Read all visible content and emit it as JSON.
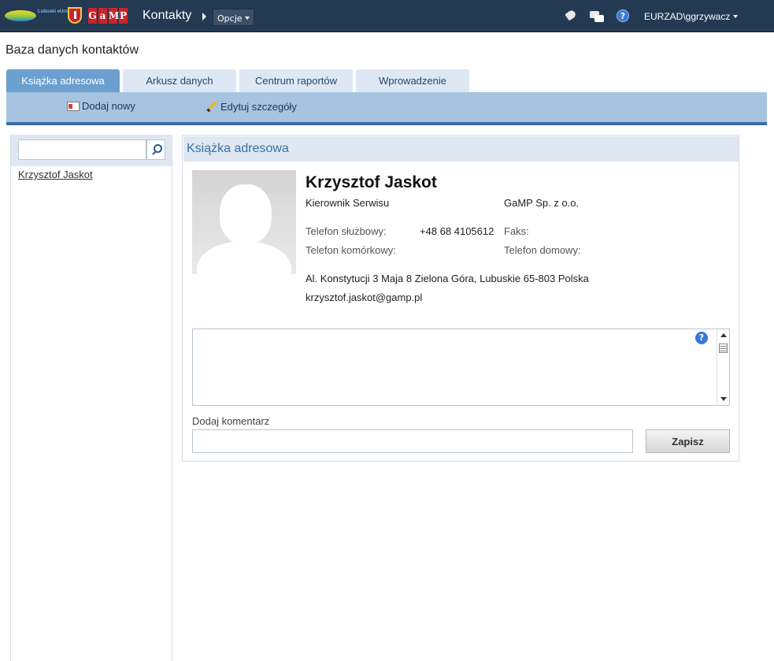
{
  "header": {
    "logo_text": "Lubuski eUrząd",
    "gamp_logo_letters": [
      "G",
      "a",
      "M",
      "P"
    ],
    "app_title": "Kontakty",
    "options_label": "Opcje",
    "user": "EURZAD\\ggrzywacz",
    "help_glyph": "?",
    "icons": [
      "tag-icon",
      "notes-icon",
      "help-icon"
    ]
  },
  "page_title": "Baza danych kontaktów",
  "tabs": [
    {
      "label": "Książka adresowa",
      "active": true
    },
    {
      "label": "Arkusz danych",
      "active": false
    },
    {
      "label": "Centrum raportów",
      "active": false
    },
    {
      "label": "Wprowadzenie",
      "active": false
    }
  ],
  "ribbon": {
    "add_new": "Dodaj nowy",
    "edit_details": "Edytuj szczegóły"
  },
  "sidebar": {
    "search_value": "",
    "contacts": [
      "Krzysztof Jaskot"
    ]
  },
  "detail": {
    "header": "Książka adresowa",
    "name": "Krzysztof Jaskot",
    "job_title": "Kierownik Serwisu",
    "company": "GaMP Sp. z o.o.",
    "work_phone_label": "Telefon służbowy:",
    "work_phone": "+48 68 4105612",
    "fax_label": "Faks:",
    "fax": "",
    "mobile_label": "Telefon komórkowy:",
    "mobile": "",
    "home_phone_label": "Telefon domowy:",
    "home_phone": "",
    "address": "Al. Konstytucji 3 Maja 8 Zielona Góra, Lubuskie 65-803 Polska",
    "email": "krzysztof.jaskot@gamp.pl",
    "help_glyph": "?"
  },
  "comments": {
    "add_label": "Dodaj komentarz",
    "input_value": "",
    "save_label": "Zapisz"
  },
  "colors": {
    "topbar": "#243a52",
    "tab_active": "#6b9fcf",
    "tab_inactive": "#dde8f4",
    "ribbon": "#a6c4e0",
    "ribbon_line": "#3a6ea5",
    "header_band": "#dfe8f2"
  }
}
